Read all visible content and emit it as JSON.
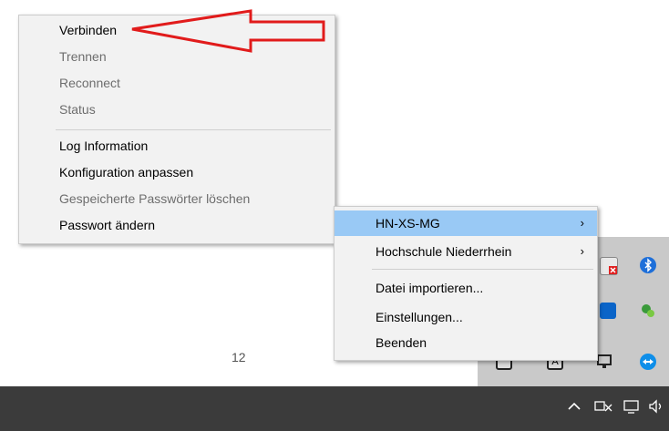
{
  "menu_left": {
    "items": [
      {
        "label": "Verbinden",
        "enabled": true
      },
      {
        "label": "Trennen",
        "enabled": false
      },
      {
        "label": "Reconnect",
        "enabled": false
      },
      {
        "label": "Status",
        "enabled": false
      },
      {
        "label": "Log Information",
        "enabled": true
      },
      {
        "label": "Konfiguration anpassen",
        "enabled": true
      },
      {
        "label": "Gespeicherte Passwörter löschen",
        "enabled": false
      },
      {
        "label": "Passwort ändern",
        "enabled": true
      }
    ]
  },
  "menu_right": {
    "items": [
      {
        "label": "HN-XS-MG",
        "submenu": true,
        "highlighted": true
      },
      {
        "label": "Hochschule Niederrhein",
        "submenu": true
      },
      {
        "label": "Datei importieren...",
        "submenu": false
      },
      {
        "label": "Einstellungen...",
        "submenu": false
      },
      {
        "label": "Beenden",
        "submenu": false
      }
    ],
    "chevron": "›"
  },
  "page_number": "12",
  "annotation": {
    "color": "#e11b1b",
    "points_to": "Verbinden"
  },
  "tray_icons": [
    "red-x-icon",
    "bluetooth-icon",
    "outlook-icon",
    "green-status-icon",
    "mail-icon",
    "font-icon",
    "display-icon",
    "teamviewer-icon"
  ],
  "taskbar_icons": [
    "chevron-up-icon",
    "network-disconnected-icon",
    "monitor-icon",
    "speaker-icon"
  ],
  "colors": {
    "highlight": "#99c9f5",
    "menu_bg": "#f2f2f2",
    "taskbar": "#3b3b3b",
    "disabled_text": "#6d6d6d"
  }
}
